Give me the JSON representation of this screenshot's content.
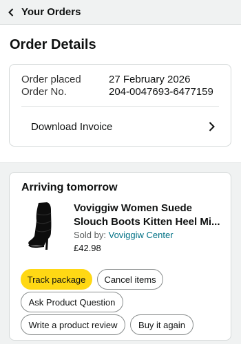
{
  "nav": {
    "back_label": "Your Orders",
    "back_icon": "chevron-left-icon"
  },
  "page": {
    "title": "Order Details"
  },
  "summary": {
    "placed_label": "Order placed",
    "placed_value": "27 February 2026",
    "number_label": "Order No.",
    "number_value": "204-0047693-6477159",
    "invoice_label": "Download Invoice",
    "invoice_icon": "chevron-right-icon"
  },
  "shipment": {
    "status": "Arriving tomorrow",
    "product": {
      "title": "Voviggiw Women Suede Slouch Boots Kitten Heel Mi...",
      "sold_by_label": "Sold by:",
      "seller": "Voviggiw Center",
      "price": "£42.98",
      "image": "black-suede-boot-image"
    },
    "actions": {
      "track": "Track package",
      "cancel": "Cancel items",
      "ask": "Ask Product Question",
      "review": "Write a product review",
      "buy_again": "Buy it again"
    }
  },
  "colors": {
    "primary_button": "#ffd814",
    "link": "#007185",
    "background": "#f0f2f2"
  }
}
